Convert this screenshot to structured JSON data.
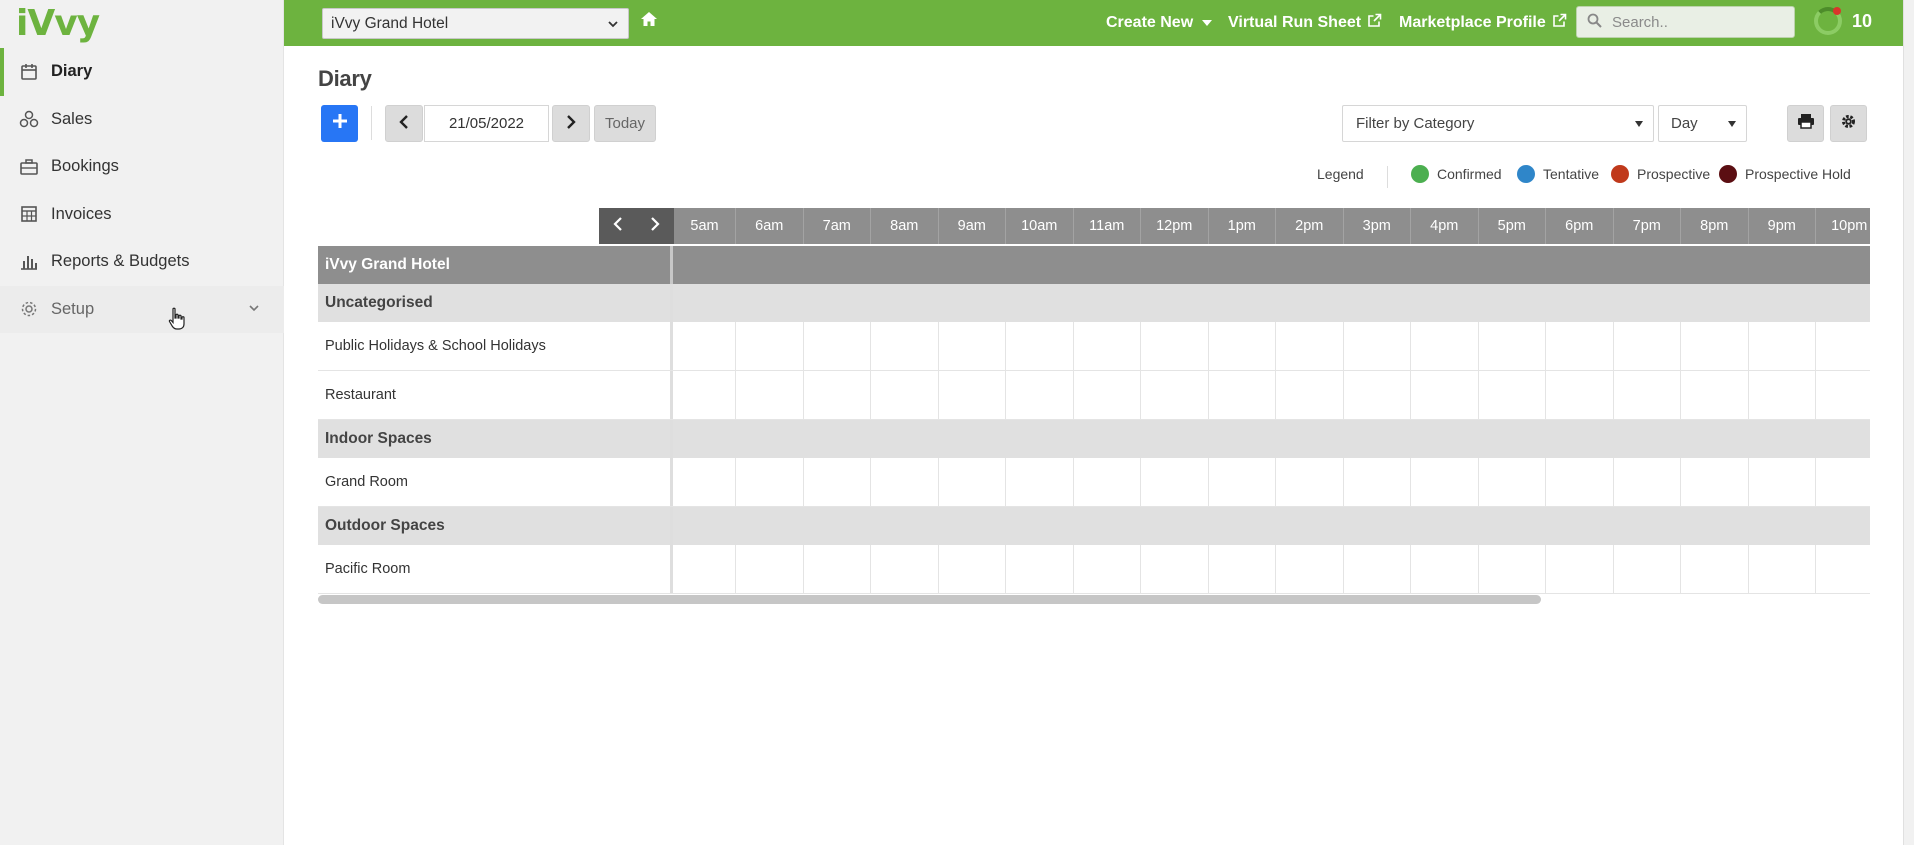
{
  "sidebar": {
    "logo": "iVvy",
    "items": [
      {
        "label": "Diary",
        "icon": "calendar-icon",
        "active": true
      },
      {
        "label": "Sales",
        "icon": "sales-icon"
      },
      {
        "label": "Bookings",
        "icon": "briefcase-icon"
      },
      {
        "label": "Invoices",
        "icon": "calculator-icon"
      },
      {
        "label": "Reports & Budgets",
        "icon": "bar-chart-icon"
      },
      {
        "label": "Setup",
        "icon": "gear-icon"
      }
    ]
  },
  "topbar": {
    "venue_select": "iVvy Grand Hotel",
    "create_new": "Create New",
    "virtual_run_sheet": "Virtual Run Sheet",
    "marketplace_profile": "Marketplace Profile",
    "search_placeholder": "Search..",
    "notification_count": "10",
    "accent_color": "#6db33f"
  },
  "diary": {
    "title": "Diary",
    "date": "21/05/2022",
    "today_label": "Today",
    "filter_category": "Filter by Category",
    "view_mode": "Day"
  },
  "legend": {
    "title": "Legend",
    "items": [
      {
        "label": "Confirmed",
        "color": "#4caf50"
      },
      {
        "label": "Tentative",
        "color": "#2f86c9"
      },
      {
        "label": "Prospective",
        "color": "#c0391b"
      },
      {
        "label": "Prospective Hold",
        "color": "#5b0e12"
      }
    ]
  },
  "grid": {
    "hours": [
      "5am",
      "6am",
      "7am",
      "8am",
      "9am",
      "10am",
      "11am",
      "12pm",
      "1pm",
      "2pm",
      "3pm",
      "4pm",
      "5pm",
      "6pm",
      "7pm",
      "8pm",
      "9pm",
      "10pm"
    ],
    "venue": "iVvy Grand Hotel",
    "rows": [
      {
        "type": "category",
        "label": "Uncategorised"
      },
      {
        "type": "space",
        "label": "Public Holidays & School Holidays"
      },
      {
        "type": "space",
        "label": "Restaurant"
      },
      {
        "type": "category",
        "label": "Indoor Spaces"
      },
      {
        "type": "space",
        "label": "Grand Room"
      },
      {
        "type": "category",
        "label": "Outdoor Spaces"
      },
      {
        "type": "space",
        "label": "Pacific Room"
      }
    ]
  }
}
